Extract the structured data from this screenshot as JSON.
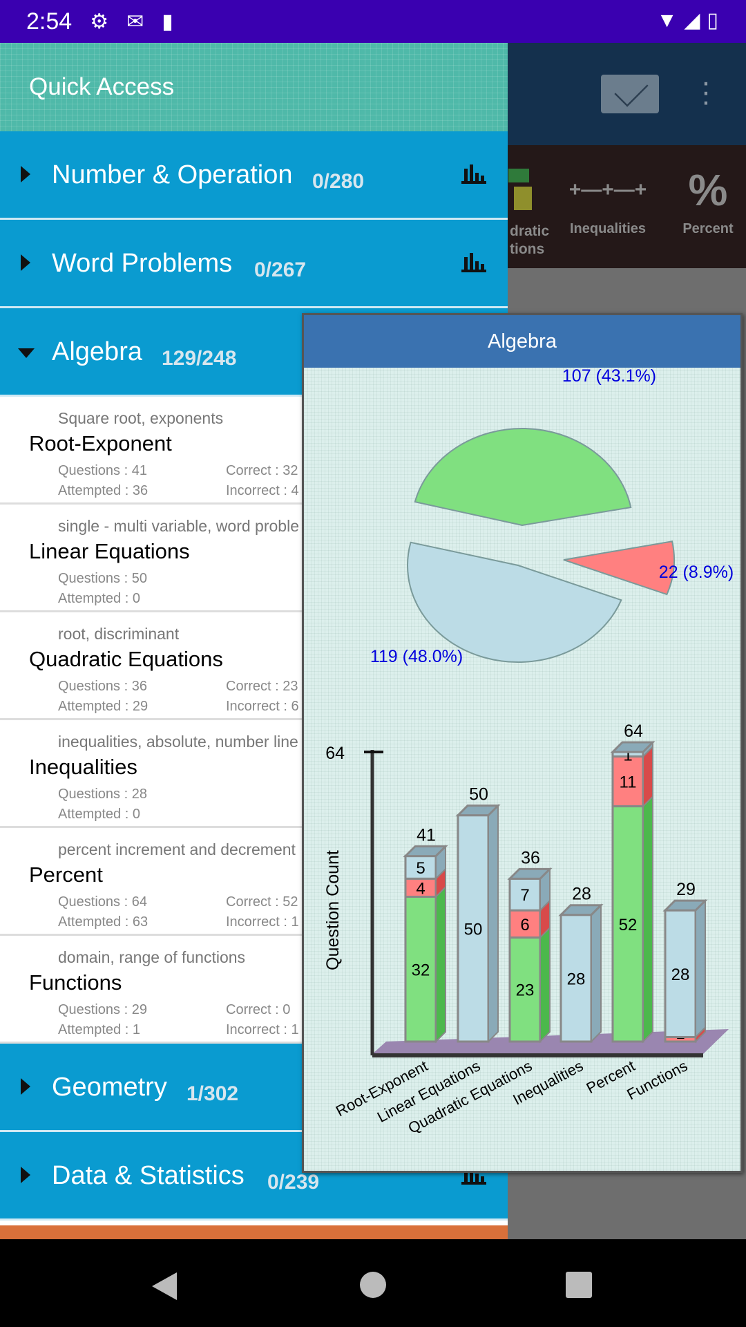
{
  "status_bar": {
    "time": "2:54",
    "icons": [
      "gear-icon",
      "gmail-icon",
      "sd-card-icon"
    ],
    "right_icons": [
      "wifi-icon",
      "signal-icon",
      "battery-charging-icon"
    ]
  },
  "background": {
    "tiles": [
      {
        "label": "Quadratic Equations",
        "visible": "dratic\ntions"
      },
      {
        "label": "Inequalities"
      },
      {
        "label": "Percent"
      }
    ],
    "envelope_icon": "envelope-icon",
    "overflow_icon": "more-vert-icon"
  },
  "drawer": {
    "header": "Quick Access",
    "categories_top": [
      {
        "name": "Number & Operation",
        "count": "0/280",
        "expanded": false
      },
      {
        "name": "Word Problems",
        "count": "0/267",
        "expanded": false
      },
      {
        "name": "Algebra",
        "count": "129/248",
        "expanded": true
      }
    ],
    "items": [
      {
        "subtitle": "Square root, exponents",
        "title": "Root-Exponent",
        "questions": "Questions : 41",
        "attempted": "Attempted : 36",
        "correct": "Correct : 32",
        "incorrect": "Incorrect : 4"
      },
      {
        "subtitle": "single - multi variable, word proble",
        "title": "Linear Equations",
        "questions": "Questions : 50",
        "attempted": "Attempted : 0"
      },
      {
        "subtitle": "root, discriminant",
        "title": "Quadratic Equations",
        "questions": "Questions : 36",
        "attempted": "Attempted : 29",
        "correct": "Correct : 23",
        "incorrect": "Incorrect : 6"
      },
      {
        "subtitle": "inequalities, absolute, number line",
        "title": "Inequalities",
        "questions": "Questions : 28",
        "attempted": "Attempted : 0"
      },
      {
        "subtitle": "percent increment and decrement",
        "title": "Percent",
        "questions": "Questions : 64",
        "attempted": "Attempted : 63",
        "correct": "Correct : 52",
        "incorrect": "Incorrect : 1"
      },
      {
        "subtitle": "domain, range of functions",
        "title": "Functions",
        "questions": "Questions : 29",
        "attempted": "Attempted : 1",
        "correct": "Correct : 0",
        "incorrect": "Incorrect : 1"
      }
    ],
    "categories_bottom": [
      {
        "name": "Geometry",
        "count": "1/302",
        "expanded": false
      },
      {
        "name": "Data & Statistics",
        "count": "0/239",
        "expanded": false
      }
    ]
  },
  "popup": {
    "title": "Algebra"
  },
  "chart_data": [
    {
      "type": "pie",
      "slices": [
        {
          "key": "correct",
          "value": 107,
          "label": "107 (43.1%)",
          "color": "#80e080"
        },
        {
          "key": "unattempted",
          "value": 119,
          "label": "119 (48.0%)",
          "color": "#bcdce6"
        },
        {
          "key": "incorrect",
          "value": 22,
          "label": "22 (8.9%)",
          "color": "#ff8080"
        }
      ],
      "label_color": "#0000dd"
    },
    {
      "type": "bar",
      "stacked": true,
      "3d": true,
      "ylabel": "Question Count",
      "ylim": [
        0,
        64
      ],
      "yticks": [
        64
      ],
      "categories": [
        "Root-Exponent",
        "Linear Equations",
        "Quadratic Equations",
        "Inequalities",
        "Percent",
        "Functions"
      ],
      "series": [
        {
          "key": "correct",
          "color": "#80e080",
          "values": [
            32,
            0,
            23,
            0,
            52,
            0
          ]
        },
        {
          "key": "incorrect",
          "color": "#ff8080",
          "values": [
            4,
            0,
            6,
            0,
            11,
            1
          ]
        },
        {
          "key": "unattempted",
          "color": "#bcdce6",
          "values": [
            5,
            50,
            7,
            28,
            1,
            28
          ]
        }
      ],
      "totals": [
        41,
        50,
        36,
        28,
        64,
        29
      ],
      "floor_color": "#9a86b0"
    }
  ]
}
